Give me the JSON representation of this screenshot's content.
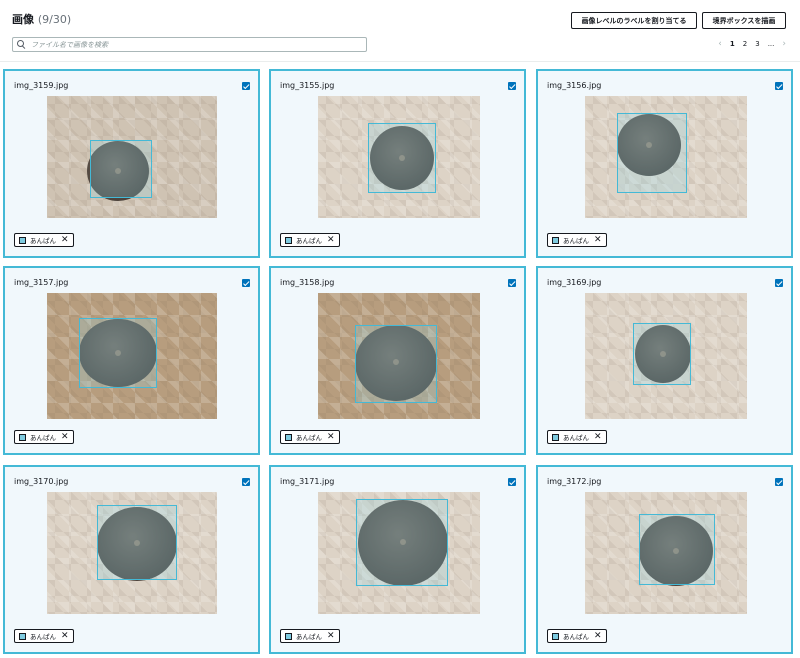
{
  "header": {
    "title": "画像",
    "count": "(9/30)",
    "assign_label_button": "画像レベルのラベルを割り当てる",
    "draw_box_button": "境界ボックスを描画"
  },
  "search": {
    "placeholder": "ファイル名で画像を検索"
  },
  "pagination": {
    "prev": "‹",
    "pages": [
      "1",
      "2",
      "3"
    ],
    "ellipsis": "...",
    "next": "›",
    "current": "1"
  },
  "label": {
    "name": "あんぱん",
    "color": "#7fcbe0",
    "remove": "✕"
  },
  "colors": {
    "accent": "#44b9d6",
    "checkbox": "#0073bb",
    "card_bg": "#f1f8fc"
  },
  "images": [
    {
      "filename": "img_3159.jpg",
      "selected": true,
      "label": "あんぱん"
    },
    {
      "filename": "img_3155.jpg",
      "selected": true,
      "label": "あんぱん"
    },
    {
      "filename": "img_3156.jpg",
      "selected": true,
      "label": "あんぱん"
    },
    {
      "filename": "img_3157.jpg",
      "selected": true,
      "label": "あんぱん"
    },
    {
      "filename": "img_3158.jpg",
      "selected": true,
      "label": "あんぱん"
    },
    {
      "filename": "img_3169.jpg",
      "selected": true,
      "label": "あんぱん"
    },
    {
      "filename": "img_3170.jpg",
      "selected": true,
      "label": "あんぱん"
    },
    {
      "filename": "img_3171.jpg",
      "selected": true,
      "label": "あんぱん"
    },
    {
      "filename": "img_3172.jpg",
      "selected": true,
      "label": "あんぱん"
    }
  ]
}
